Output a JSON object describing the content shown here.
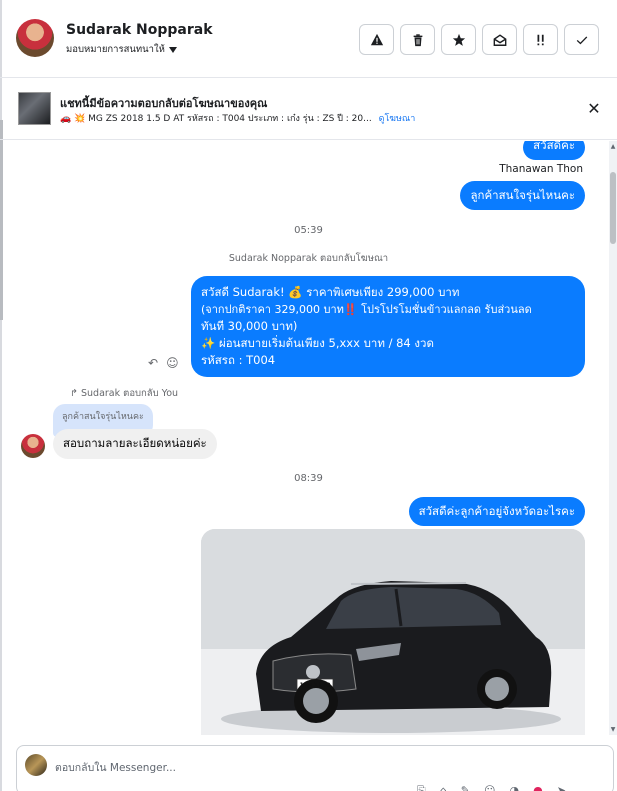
{
  "header": {
    "name": "Sudarak Nopparak",
    "assign_label": "มอบหมายการสนทนาให้",
    "actions": [
      "spam-icon",
      "trash-icon",
      "star-icon",
      "mark-unread-icon",
      "follow-up-icon",
      "done-icon"
    ]
  },
  "ad": {
    "title": "แชทนี้มีข้อความตอบกลับต่อโฆษณาของคุณ",
    "emoji": "🚗 💥",
    "description": "MG ZS 2018 1.5 D AT รหัสรถ : T004 ประเภท : เก๋ง รุ่น : ZS ปี : 20...",
    "link": "ดูโฆษณา"
  },
  "messages": {
    "m1": "สวัสดีคะ",
    "sender": "Thanawan Thon",
    "m2": "ลูกค้าสนใจรุ่นไหนคะ",
    "time1": "05:39",
    "reply_meta": "Sudarak Nopparak ตอบกลับโฆษณา",
    "m3_line1": "สวัสดี Sudarak! 💰 ราคาพิเศษเพียง 299,000 บาท",
    "m3_line2": "(จากปกติราคา 329,000 บาท‼️ โปรโปรโมชั่นข้าวแลกลด รับส่วนลด",
    "m3_line3": "ทันที 30,000 บาท)",
    "m3_line4": "✨ ผ่อนสบายเริ่มต้นเพียง 5,xxx บาท / 84 งวด",
    "m3_line5": "รหัสรถ : T004",
    "replied_to_meta": "Sudarak ตอบกลับ You",
    "quoted": "ลูกค้าสนใจรุ่นไหนคะ",
    "m4": "สอบถามลายละเอียดหน่อยค่ะ",
    "time2": "08:39",
    "m5": "สวัสดีค่ะลูกค้าอยู่จังหวัดอะไรคะ",
    "plate": "1ขษ 1170"
  },
  "composer": {
    "placeholder": "ตอบกลับใน Messenger..."
  },
  "colors": {
    "outgoing": "#0a7cff",
    "incoming": "#f0f0f0",
    "link": "#1877f2"
  }
}
